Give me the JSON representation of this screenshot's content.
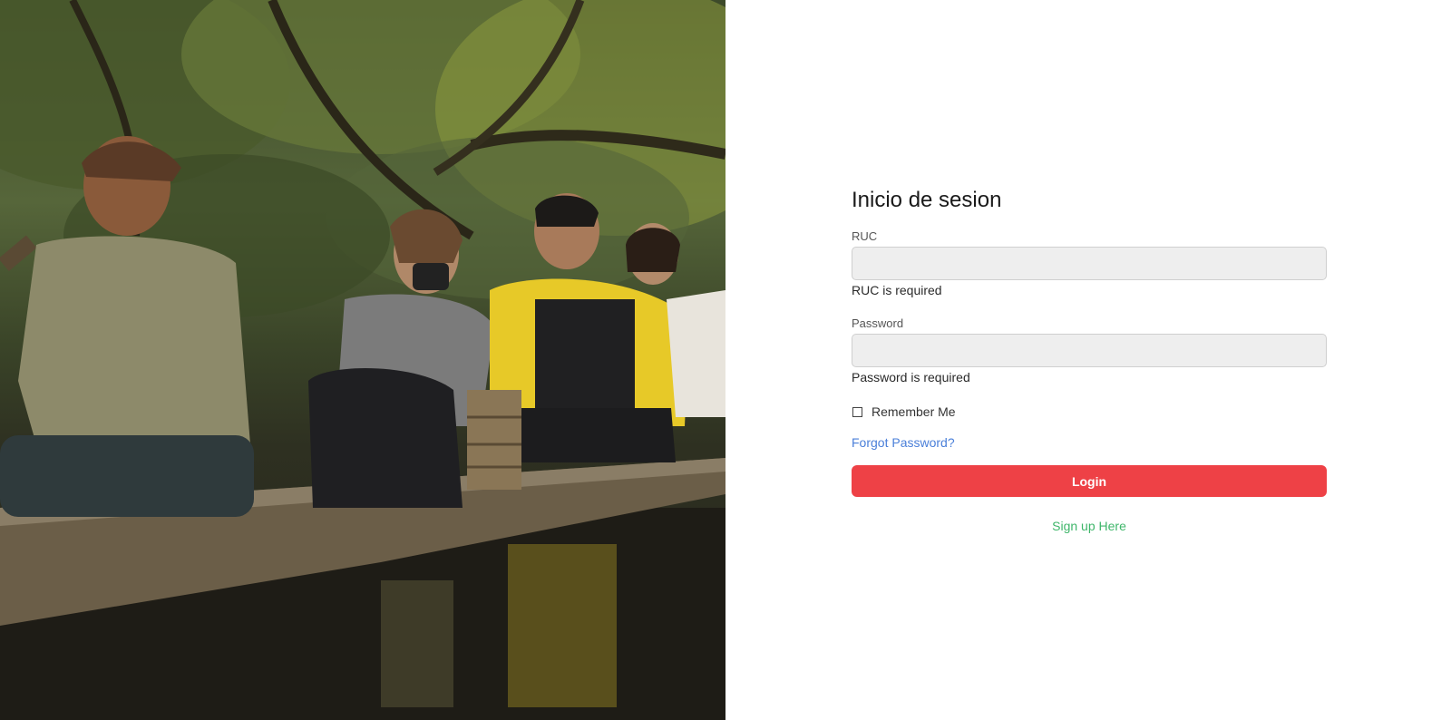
{
  "hero": {
    "image_description_icon": "canoe-photo"
  },
  "form": {
    "title": "Inicio de sesion",
    "ruc_label": "RUC",
    "ruc_value": "",
    "ruc_error": "RUC is required",
    "password_label": "Password",
    "password_value": "",
    "password_error": "Password is required",
    "remember_label": "Remember Me",
    "remember_checked": false,
    "forgot_label": "Forgot Password?",
    "login_label": "Login",
    "signup_label": "Sign up Here"
  },
  "colors": {
    "login_button": "#ee4146",
    "forgot_link": "#4a7fd9",
    "signup_link": "#3fb66a",
    "input_background": "#eeeeee"
  }
}
